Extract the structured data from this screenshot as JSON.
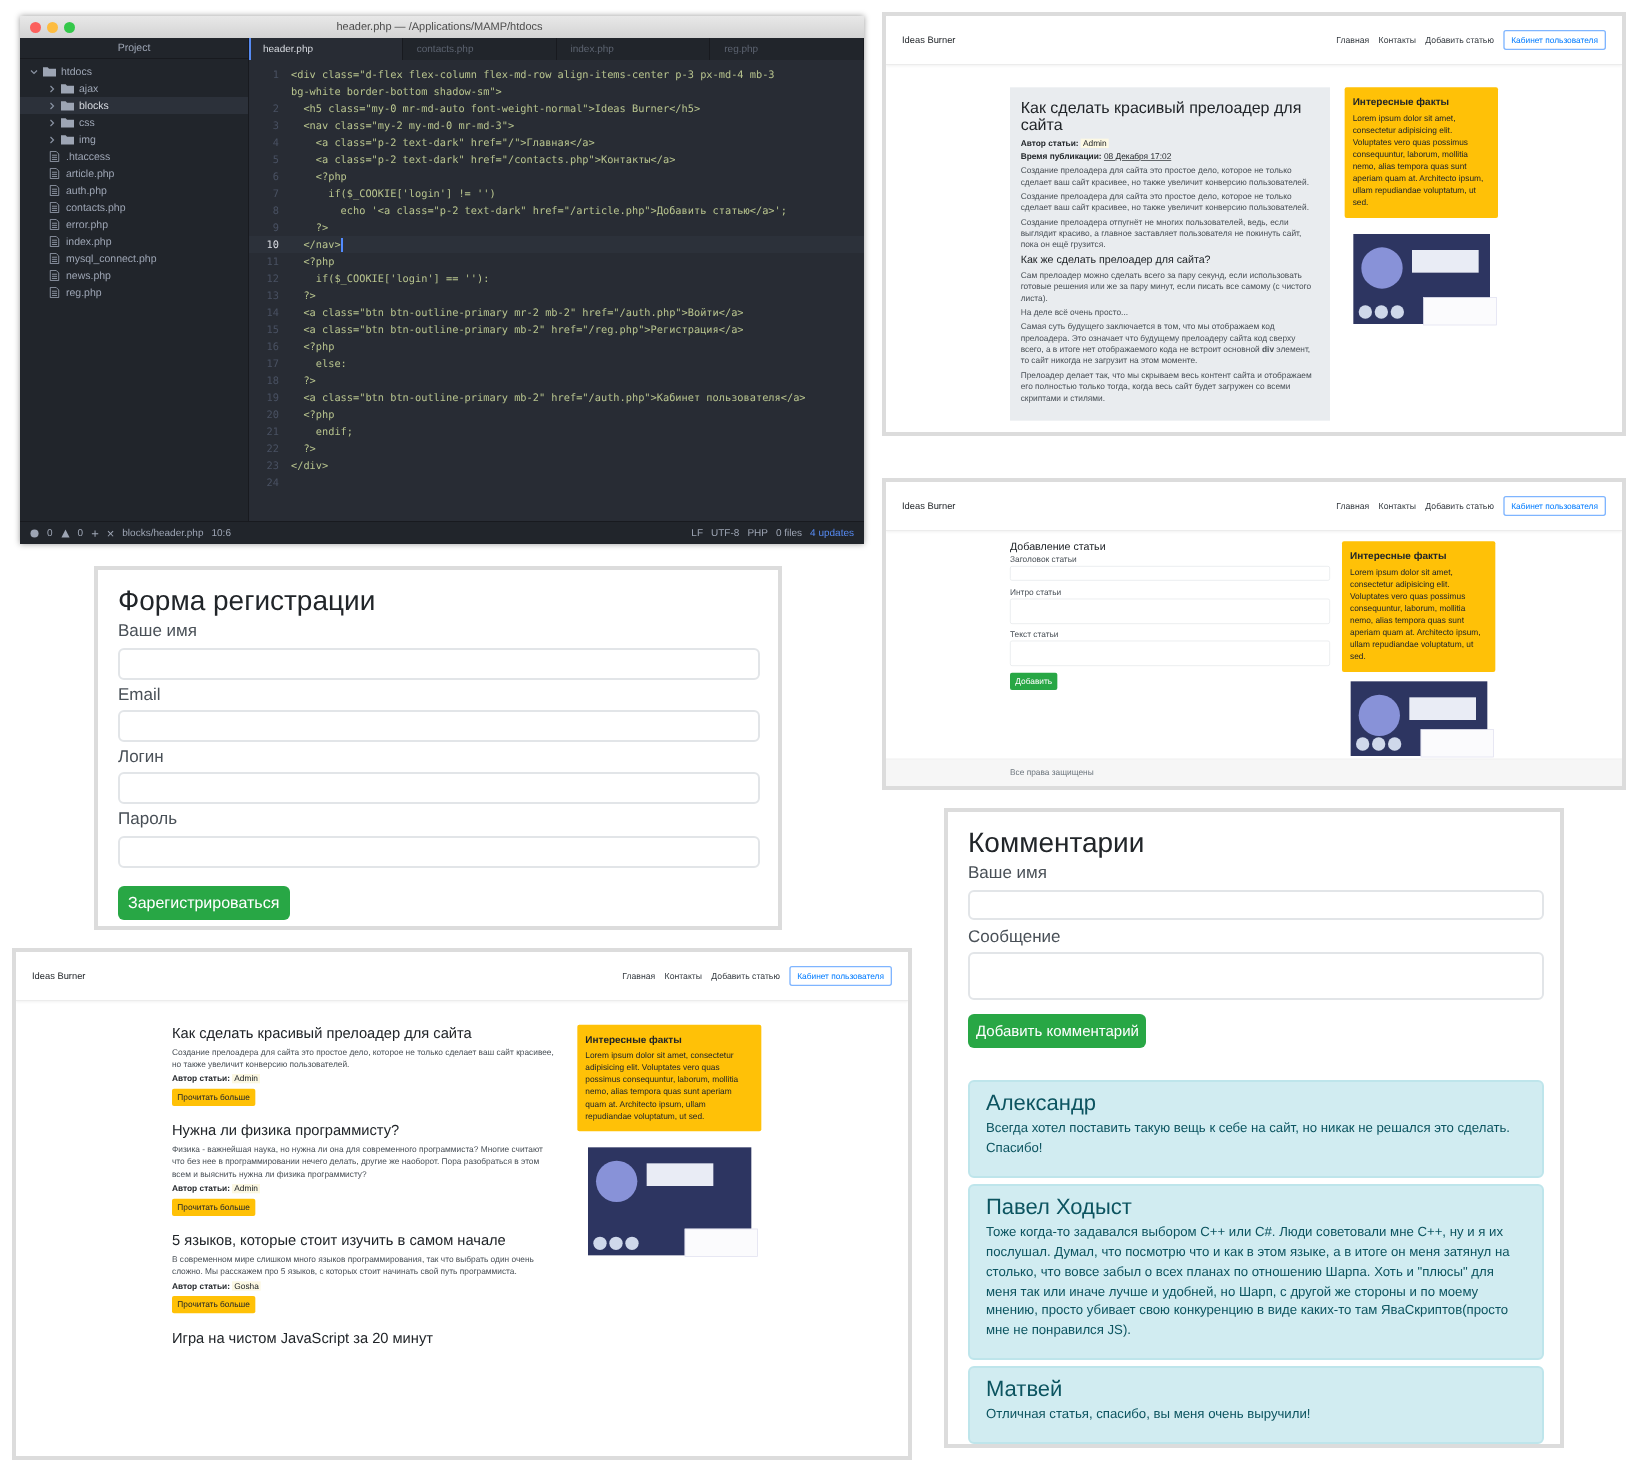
{
  "code_editor": {
    "title": "header.php — /Applications/MAMP/htdocs",
    "project_label": "Project",
    "tree": [
      {
        "name": "htdocs",
        "kind": "folder",
        "expanded": true,
        "selected": false,
        "children": [
          {
            "name": "ajax",
            "kind": "folder",
            "expanded": false,
            "selected": false
          },
          {
            "name": "blocks",
            "kind": "folder",
            "expanded": false,
            "selected": true
          },
          {
            "name": "css",
            "kind": "folder",
            "expanded": false,
            "selected": false
          },
          {
            "name": "img",
            "kind": "folder",
            "expanded": false,
            "selected": false
          },
          {
            "name": ".htaccess",
            "kind": "file",
            "selected": false
          },
          {
            "name": "article.php",
            "kind": "file",
            "selected": false
          },
          {
            "name": "auth.php",
            "kind": "file",
            "selected": false
          },
          {
            "name": "contacts.php",
            "kind": "file",
            "selected": false
          },
          {
            "name": "error.php",
            "kind": "file",
            "selected": false
          },
          {
            "name": "index.php",
            "kind": "file",
            "selected": false
          },
          {
            "name": "mysql_connect.php",
            "kind": "file",
            "selected": false
          },
          {
            "name": "news.php",
            "kind": "file",
            "selected": false
          },
          {
            "name": "reg.php",
            "kind": "file",
            "selected": false
          }
        ]
      }
    ],
    "tabs": [
      {
        "label": "header.php",
        "selected": true
      },
      {
        "label": "contacts.php",
        "selected": false
      },
      {
        "label": "index.php",
        "selected": false
      },
      {
        "label": "reg.php",
        "selected": false
      }
    ],
    "lines": [
      {
        "number": "1",
        "code": "<div class=\"d-flex flex-column flex-md-row align-items-center p-3 px-md-4 mb-3",
        "current": false
      },
      {
        "code": "bg-white border-bottom shadow-sm\">",
        "current": false
      },
      {
        "number": "2",
        "code": "  <h5 class=\"my-0 mr-md-auto font-weight-normal\">Ideas Burner</h5>",
        "current": false
      },
      {
        "number": "3",
        "code": "  <nav class=\"my-2 my-md-0 mr-md-3\">",
        "current": false
      },
      {
        "number": "4",
        "code": "    <a class=\"p-2 text-dark\" href=\"/\">Главная</a>",
        "current": false
      },
      {
        "number": "5",
        "code": "    <a class=\"p-2 text-dark\" href=\"/contacts.php\">Контакты</a>",
        "current": false
      },
      {
        "number": "6",
        "code": "    <?php",
        "current": false
      },
      {
        "number": "7",
        "code": "      if($_COOKIE['login'] != '')",
        "current": false
      },
      {
        "number": "8",
        "code": "        echo '<a class=\"p-2 text-dark\" href=\"/article.php\">Добавить статью</a>';",
        "current": false
      },
      {
        "number": "9",
        "code": "    ?>",
        "current": false
      },
      {
        "number": "10",
        "code": "  </nav>",
        "current": true
      },
      {
        "number": "11",
        "code": "  <?php",
        "current": false
      },
      {
        "number": "12",
        "code": "    if($_COOKIE['login'] == ''):",
        "current": false
      },
      {
        "number": "13",
        "code": "  ?>",
        "current": false
      },
      {
        "number": "14",
        "code": "  <a class=\"btn btn-outline-primary mr-2 mb-2\" href=\"/auth.php\">Войти</a>",
        "current": false
      },
      {
        "number": "15",
        "code": "  <a class=\"btn btn-outline-primary mb-2\" href=\"/reg.php\">Регистрация</a>",
        "current": false
      },
      {
        "number": "16",
        "code": "  <?php",
        "current": false
      },
      {
        "number": "17",
        "code": "    else:",
        "current": false
      },
      {
        "number": "18",
        "code": "  ?>",
        "current": false
      },
      {
        "number": "19",
        "code": "  <a class=\"btn btn-outline-primary mb-2\" href=\"/auth.php\">Кабинет пользователя</a>",
        "current": false
      },
      {
        "number": "20",
        "code": "  <?php",
        "current": false
      },
      {
        "number": "21",
        "code": "    endif;",
        "current": false
      },
      {
        "number": "22",
        "code": "  ?>",
        "current": false
      },
      {
        "number": "23",
        "code": "</div>",
        "current": false
      },
      {
        "number": "24",
        "current": false
      }
    ],
    "status_bar": {
      "errors": "0",
      "warnings": "0",
      "add": "+",
      "close": "×",
      "file": "blocks/header.php",
      "cursor": "10:6",
      "line_ending": "LF",
      "encoding": "UTF-8",
      "grammar": "PHP",
      "git": "0 files",
      "updates": "4 updates"
    }
  },
  "article_page": {
    "navbar": {
      "brand": "Ideas Burner",
      "links": [
        "Главная",
        "Контакты",
        "Добавить статью"
      ],
      "button": "Кабинет пользователя"
    },
    "article": {
      "title": "Как сделать красивый прелоадер для сайта",
      "author_label": "Автор статьи:",
      "author": "Admin",
      "date_label": "Время публикации:",
      "date": "08 Декабря 17:02",
      "blocks": [
        {
          "kind": "p",
          "text": "Создание прелоадера для сайта это простое дело, которое не только сделает ваш сайт красивее, но также увеличит конверсию пользователей."
        },
        {
          "kind": "p",
          "text": "Создание прелоадера для сайта это простое дело, которое не только сделает ваш сайт красивее, но также увеличит конверсию пользователей."
        },
        {
          "kind": "p",
          "text": "Создание прелоадера отпугнёт не многих пользователей, ведь, если выглядит красиво, а главное заставляет пользователя не покинуть сайт, пока он ещё грузится."
        },
        {
          "kind": "h",
          "text": "Как же сделать прелоадер для сайта?"
        },
        {
          "kind": "p",
          "text": "Сам прелоадер можно сделать всего за пару секунд, если использовать готовые решения или же за пару минут, если писать все самому (с чистого листа)."
        },
        {
          "kind": "p",
          "text": "На деле всё очень просто..."
        },
        {
          "kind": "p",
          "text": "Самая суть будущего заключается в том, что мы отображаем код прелоадера. Это означает что будущему прелоадеру сайта код сверху всего, а в итоге нет отображаемого кода не встроит основной **div** элемент, то сайт никогда не загрузит на этом моменте."
        },
        {
          "kind": "p",
          "text": "Прелоадер делает так, что мы скрываем весь контент сайта и отображаем его полностью только тогда, когда весь сайт будет загружен со всеми скриптами и стилями."
        }
      ]
    },
    "sidebar": {
      "title": "Интересные факты",
      "text": "Lorem ipsum dolor sit amet, consectetur adipisicing elit. Voluptates vero quas possimus consequuntur, laborum, mollitia nemo, alias tempora quas sunt aperiam quam at. Architecto ipsum, ullam repudiandae voluptatum, ut sed."
    }
  },
  "add_article_page": {
    "navbar": {
      "brand": "Ideas Burner",
      "links": [
        "Главная",
        "Контакты",
        "Добавить статью"
      ],
      "button": "Кабинет пользователя"
    },
    "form": {
      "title": "Добавление статьи",
      "fields": [
        {
          "label": "Заголовок статьи",
          "kind": "input"
        },
        {
          "label": "Интро статьи",
          "kind": "textarea"
        },
        {
          "label": "Текст статьи",
          "kind": "textarea"
        }
      ],
      "button": "Добавить"
    },
    "sidebar": {
      "title": "Интересные факты",
      "text": "Lorem ipsum dolor sit amet, consectetur adipisicing elit. Voluptates vero quas possimus consequuntur, laborum, mollitia nemo, alias tempora quas sunt aperiam quam at. Architecto ipsum, ullam repudiandae voluptatum, ut sed."
    },
    "footer": "Все права защищены"
  },
  "registration_form": {
    "title": "Форма регистрации",
    "fields": [
      {
        "label": "Ваше имя",
        "kind": "input"
      },
      {
        "label": "Email",
        "kind": "input"
      },
      {
        "label": "Логин",
        "kind": "input"
      },
      {
        "label": "Пароль",
        "kind": "input"
      }
    ],
    "button": "Зарегистрироваться"
  },
  "comments": {
    "title": "Комментарии",
    "fields": [
      {
        "label": "Ваше имя",
        "kind": "input"
      },
      {
        "label": "Сообщение",
        "kind": "textarea"
      }
    ],
    "button": "Добавить комментарий",
    "items": [
      {
        "author": "Александр",
        "text": "Всегда хотел поставить такую вещь к себе на сайт, но никак не решался это сделать. Спасибо!"
      },
      {
        "author": "Павел Ходыст",
        "text": "Тоже когда-то задавался выбором С++ или С#. Люди советовали мне С++, ну и я их послушал. Думал, что посмотрю что и как в этом языке, а в итоге он меня затянул на столько, что вовсе забыл о всех планах по отношению Шарпа. Хоть и \"плюсы\" для меня так или иначе лучше и удобней, но Шарп, с другой же стороны и по моему мнению, просто убивает свою конкуренцию в виде каких-то там ЯваСкриптов(просто мне не понравился JS)."
      },
      {
        "author": "Матвей",
        "text": "Отличная статья, спасибо, вы меня очень выручили!"
      }
    ]
  },
  "home_page": {
    "navbar": {
      "brand": "Ideas Burner",
      "links": [
        "Главная",
        "Контакты",
        "Добавить статью"
      ],
      "button": "Кабинет пользователя"
    },
    "articles": [
      {
        "title": "Как сделать красивый прелоадер для сайта",
        "intro": "Создание прелоадера для сайта это простое дело, которое не только сделает ваш сайт красивее, но также увеличит конверсию пользователей.",
        "author_label": "Автор статьи:",
        "author": "Admin",
        "button": "Прочитать больше"
      },
      {
        "title": "Нужна ли физика программисту?",
        "intro": "Физика - важнейшая наука, но нужна ли она для современного программиста? Многие считают что без нее в программировании нечего делать, другие же наоборот. Пора разобраться в этом всем и выяснить нужна ли физика программисту?",
        "author_label": "Автор статьи:",
        "author": "Admin",
        "button": "Прочитать больше"
      },
      {
        "title": "5 языков, которые стоит изучить в самом начале",
        "intro": "В современном мире слишком много языков программирования, так что выбрать один очень сложно. Мы расскажем про 5 языков, с которых стоит начинать свой путь программиста.",
        "author_label": "Автор статьи:",
        "author": "Gosha",
        "button": "Прочитать больше"
      },
      {
        "title": "Игра на чистом JavaScript за 20 минут"
      }
    ],
    "sidebar": {
      "title": "Интересные факты",
      "text": "Lorem ipsum dolor sit amet, consectetur adipisicing elit. Voluptates vero quas possimus consequuntur, laborum, mollitia nemo, alias tempora quas sunt aperiam quam at. Architecto ipsum, ullam repudiandae voluptatum, ut sed."
    }
  }
}
